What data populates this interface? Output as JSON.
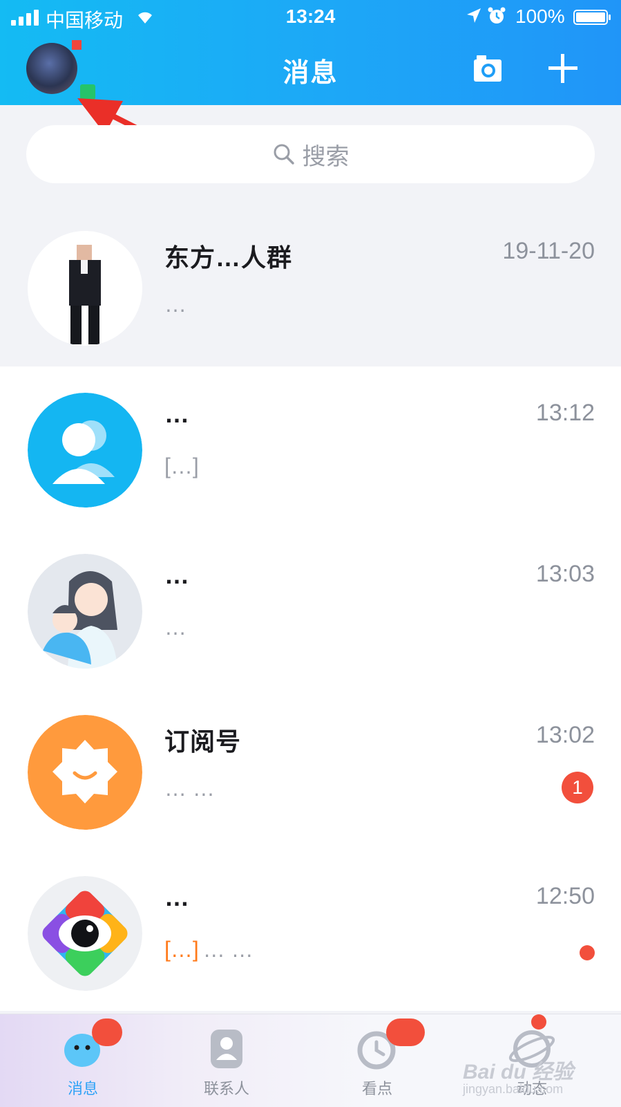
{
  "status_bar": {
    "carrier": "中国移动",
    "time": "13:24",
    "battery": "100%"
  },
  "header": {
    "title": "消息"
  },
  "search": {
    "placeholder": "搜索"
  },
  "chats": [
    {
      "name": "东方…人群",
      "time": "19-11-20",
      "preview": "…",
      "pinned": true
    },
    {
      "name": "…",
      "time": "13:12",
      "preview": "[…]"
    },
    {
      "name": "…",
      "time": "13:03",
      "preview": "…"
    },
    {
      "name": "订阅号",
      "time": "13:02",
      "preview": "… …",
      "unread": "1"
    },
    {
      "name": "…",
      "time": "12:50",
      "preview_tag": "[…]",
      "preview": "… …",
      "dot": true
    }
  ],
  "tabbar": {
    "tabs": [
      {
        "label": "消息",
        "active": true
      },
      {
        "label": "联系人"
      },
      {
        "label": "看点"
      },
      {
        "label": "动态"
      }
    ]
  },
  "watermark": {
    "brand": "Bai du 经验",
    "url": "jingyan.baidu.com"
  },
  "colors": {
    "header_gradient_start": "#14bbf3",
    "header_gradient_end": "#2095f8",
    "badge_red": "#f24f3c",
    "active_tab": "#2da2f6"
  },
  "icons": [
    "signal-icon",
    "wifi-icon",
    "location-icon",
    "alarm-icon",
    "battery-icon",
    "camera-icon",
    "plus-icon",
    "search-icon"
  ]
}
